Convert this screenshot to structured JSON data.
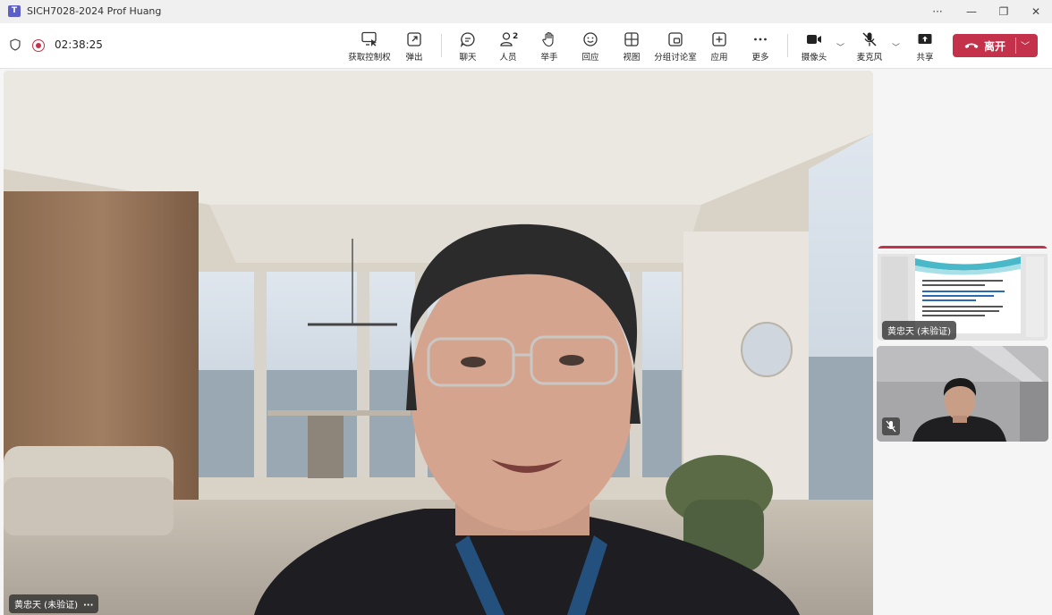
{
  "window": {
    "title": "SICH7028-2024 Prof Huang",
    "app_logo": "T",
    "controls": {
      "more": "···",
      "minimize": "—",
      "restore": "❐",
      "close": "✕"
    }
  },
  "meeting": {
    "timer": "02:38:25",
    "toolbar": [
      {
        "id": "take-control",
        "label": "获取控制权",
        "icon": "take-control-icon"
      },
      {
        "id": "popout",
        "label": "弹出",
        "icon": "popout-icon"
      },
      {
        "id": "chat",
        "label": "聊天",
        "icon": "chat-icon"
      },
      {
        "id": "people",
        "label": "人员",
        "icon": "people-icon",
        "count": "2"
      },
      {
        "id": "raise-hand",
        "label": "举手",
        "icon": "hand-icon"
      },
      {
        "id": "react",
        "label": "回应",
        "icon": "smiley-icon"
      },
      {
        "id": "view",
        "label": "视图",
        "icon": "grid-icon"
      },
      {
        "id": "breakout",
        "label": "分组讨论室",
        "icon": "breakout-icon"
      },
      {
        "id": "apps",
        "label": "应用",
        "icon": "plus-icon"
      },
      {
        "id": "more",
        "label": "更多",
        "icon": "more-icon"
      },
      {
        "id": "camera",
        "label": "摄像头",
        "icon": "camera-icon"
      },
      {
        "id": "mic",
        "label": "麦克风",
        "icon": "mic-off-icon"
      },
      {
        "id": "share",
        "label": "共享",
        "icon": "share-icon"
      }
    ],
    "leave_label": "离开",
    "colors": {
      "leave": "#c4314b",
      "toolbar_bg": "#ffffff",
      "stage_bg": "#f5f5f5"
    }
  },
  "stage": {
    "speaker_name": "黄忠天 (未验证)",
    "more": "···"
  },
  "side_tiles": [
    {
      "name": "黄忠天 (未验证)"
    },
    {
      "name": ""
    }
  ]
}
